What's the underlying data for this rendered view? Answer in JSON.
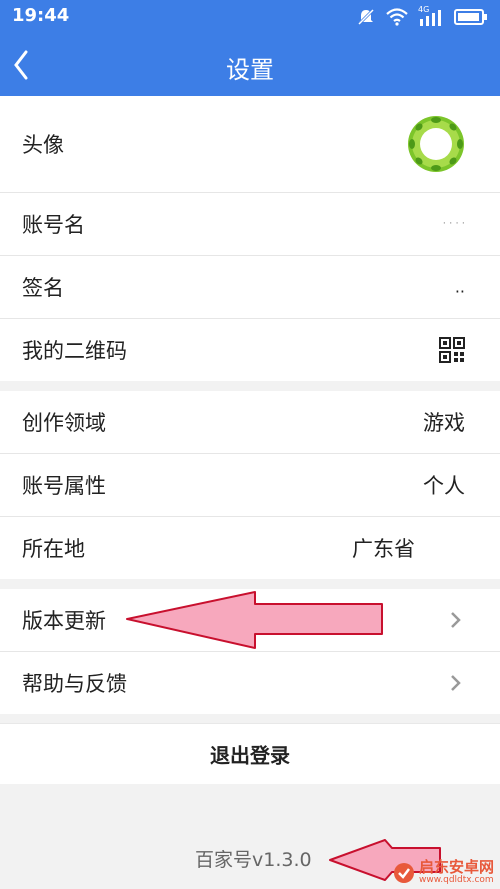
{
  "status_bar": {
    "time": "19:44",
    "signal_label": "4G"
  },
  "header": {
    "title": "设置"
  },
  "profile_group": [
    {
      "label": "头像"
    },
    {
      "label": "账号名",
      "value": "·  ·  ·  ·"
    },
    {
      "label": "签名",
      "value": ".."
    },
    {
      "label": "我的二维码"
    }
  ],
  "info_group": [
    {
      "label": "创作领域",
      "value": "游戏"
    },
    {
      "label": "账号属性",
      "value": "个人"
    },
    {
      "label": "所在地",
      "value": "广东省"
    }
  ],
  "action_group": [
    {
      "label": "版本更新"
    },
    {
      "label": "帮助与反馈"
    }
  ],
  "logout": {
    "label": "退出登录"
  },
  "version": "百家号v1.3.0",
  "watermark": {
    "text": "启东安卓网",
    "url": "www.qdldtx.com"
  },
  "colors": {
    "header": "#3d7ee6",
    "annotation_arrow": "#f7a8bd"
  }
}
